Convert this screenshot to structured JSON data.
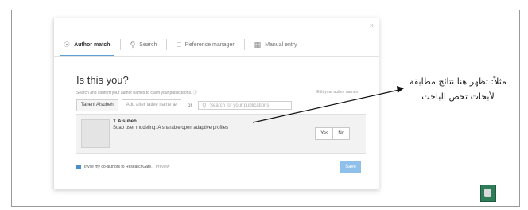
{
  "dialog": {
    "close_label": "×",
    "tabs": [
      {
        "label": "Author match",
        "icon": "person-icon"
      },
      {
        "label": "Search",
        "icon": "search-icon"
      },
      {
        "label": "Reference manager",
        "icon": "document-icon"
      },
      {
        "label": "Manual entry",
        "icon": "form-icon"
      }
    ],
    "title": "Is this you?",
    "subtitle": "Search and confirm your author names to claim your publications. ⓘ",
    "edit_link": "Edit your author names",
    "author_name_chip": "Taheni Alsubeh",
    "alt_name_placeholder": "Add alternative name ⊕",
    "or_label": "or",
    "search_placeholder": "Q | Search for your publications",
    "result": {
      "author": "T. Alsubeh",
      "publication": "Soap user modeling: A sharable open adaptive profiles",
      "yes_label": "Yes",
      "no_label": "No"
    },
    "invite_label": "Invite my co-authors to ResearchGate.",
    "preview_label": "Preview",
    "save_label": "Save"
  },
  "annotation": {
    "line1": "مثلاً: تظهر هنا نتائج مطابقة",
    "line2": "لأبحاث تخص الباحث"
  }
}
